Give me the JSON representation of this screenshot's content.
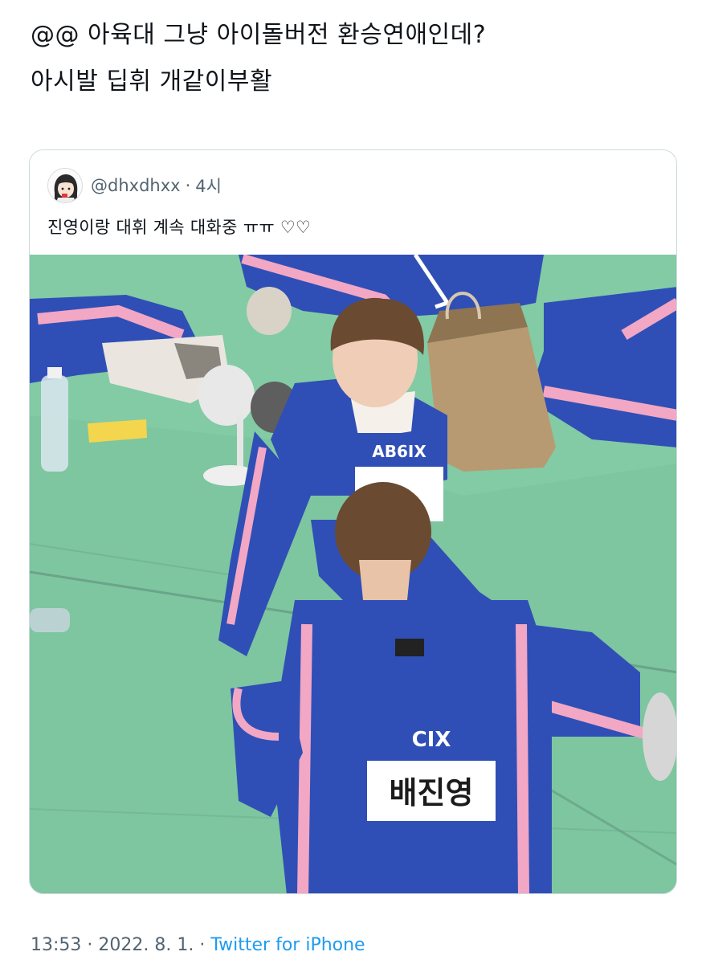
{
  "tweet": {
    "lines": [
      "@@ 아육대 그냥 아이돌버전 환승연애인데?",
      "아시발 딥휘 개같이부활"
    ]
  },
  "quote": {
    "author_handle": "@dhxdhxx",
    "separator": "·",
    "time": "4시",
    "text": "진영이랑 대휘 계속 대화중 ㅠㅠ ♡♡",
    "photo": {
      "bib_front_top": "AB6IX",
      "bib_back_top": "CIX",
      "bib_back_name": "배진영"
    }
  },
  "meta": {
    "time": "13:53",
    "dot": "·",
    "date": "2022. 8. 1.",
    "source": "Twitter for iPhone"
  },
  "colors": {
    "floor": "#7dc6a0",
    "tracksuit_blue": "#2f4fb6",
    "tracksuit_pink": "#f2a7c4",
    "link_blue": "#1d9bf0"
  }
}
